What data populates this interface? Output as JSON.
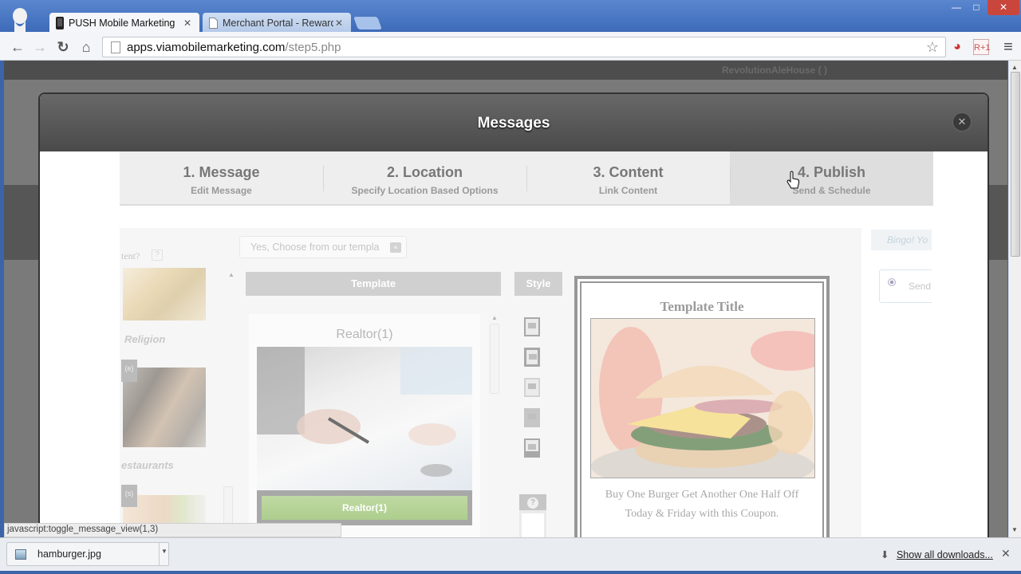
{
  "browser": {
    "tabs": [
      {
        "label": "PUSH Mobile Marketing",
        "icon": "phone-icon",
        "active": true
      },
      {
        "label": "Merchant Portal - Rewards",
        "icon": "page-icon",
        "active": false
      }
    ],
    "url_host": "apps.viamobilemarketing.com",
    "url_path": "/step5.php",
    "window_controls": {
      "minimize": "—",
      "maximize": "□",
      "close": "✕"
    },
    "extensions": [
      {
        "name": "translate-extension-icon",
        "glyph": "◕"
      },
      {
        "name": "r-plus-one-extension-icon",
        "glyph": "R+1"
      }
    ],
    "menu_glyph": "≡"
  },
  "page": {
    "account_label": "RevolutionAleHouse (          )"
  },
  "modal": {
    "title": "Messages",
    "close_glyph": "✕",
    "steps": [
      {
        "title": "1. Message",
        "subtitle": "Edit Message",
        "current": false
      },
      {
        "title": "2. Location",
        "subtitle": "Specify Location Based Options",
        "current": false
      },
      {
        "title": "3. Content",
        "subtitle": "Link Content",
        "current": false
      },
      {
        "title": "4. Publish",
        "subtitle": "Send & Schedule",
        "current": true
      }
    ],
    "content": {
      "question_fragment": "tent?",
      "help_glyph": "?",
      "template_choice": "Yes, Choose from our templa",
      "categories": [
        {
          "label": "Religion"
        },
        {
          "label": "estaurants",
          "badge": "(e)"
        },
        {
          "label": "",
          "badge": "(s)"
        }
      ],
      "template_panel_header": "Template",
      "style_panel_header": "Style",
      "template_card": {
        "name": "Realtor(1)",
        "button_label": "Realtor(1)"
      },
      "preview": {
        "title": "Template Title",
        "body_line1": "Buy One Burger Get Another One Half Off",
        "body_line2": "Today & Friday with this Coupon."
      },
      "publish": {
        "bingo_text": "Bingo! Yo",
        "send_option": "Send"
      }
    }
  },
  "status_text": "javascript:toggle_message_view(1,3)",
  "downloads": {
    "items": [
      {
        "name": "hamburger.jpg"
      }
    ],
    "show_all": "Show all downloads...",
    "close_glyph": "✕"
  }
}
